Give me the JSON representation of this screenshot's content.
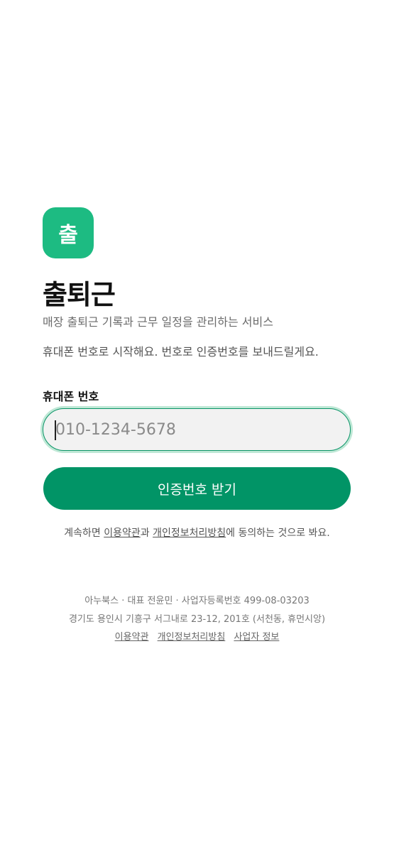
{
  "app": {
    "logo_glyph": "출",
    "title": "출퇴근",
    "subtitle": "매장 출퇴근 기록과 근무 일정을 관리하는 서비스",
    "helper": "휴대폰 번호로 시작해요. 번호로 인증번호를 보내드릴게요.",
    "accent_color": "#1dbb82",
    "button_color": "#019466"
  },
  "phone": {
    "label": "휴대폰 번호",
    "placeholder": "010-1234-5678",
    "value": ""
  },
  "cta": {
    "label": "인증번호 받기"
  },
  "consent": {
    "prefix": "계속하면 ",
    "terms_link": "이용약관",
    "middle": "과 ",
    "privacy_link": "개인정보처리방침",
    "suffix": "에 동의하는 것으로 봐요."
  },
  "footer": {
    "line1": "아누북스 · 대표 전윤민 · 사업자등록번호 499-08-03203",
    "line2": "경기도 용인시 기흥구 서그내로 23-12, 201호 (서천동, 휴먼시앙)",
    "links": [
      "이용약관",
      "개인정보처리방침",
      "사업자 정보"
    ]
  }
}
